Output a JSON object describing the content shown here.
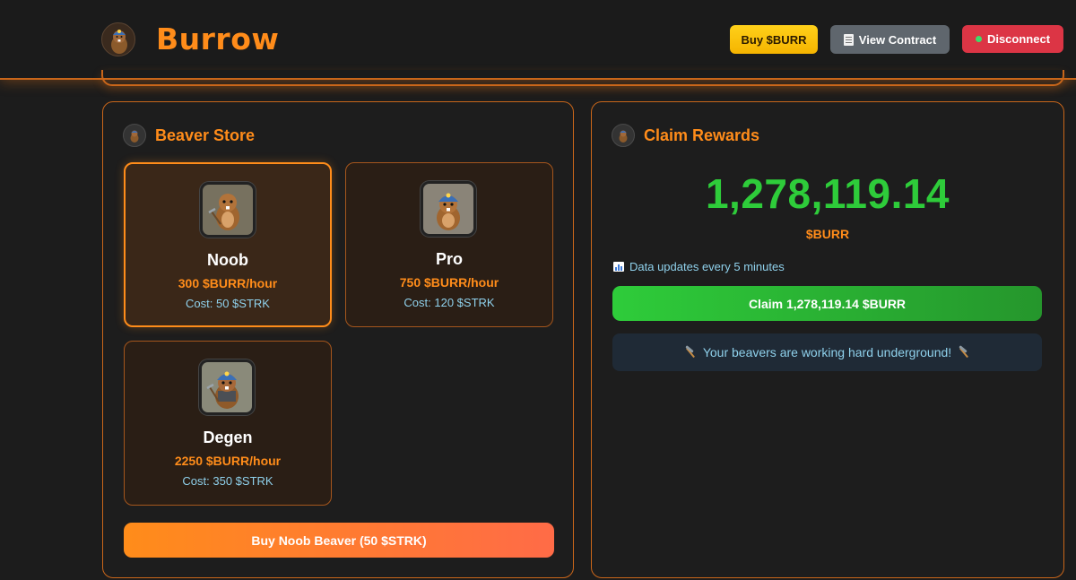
{
  "header": {
    "brand": "Burrow",
    "buy_label": "Buy $BURR",
    "view_contract_label": "View Contract",
    "disconnect_label": "Disconnect"
  },
  "store": {
    "title": "Beaver Store",
    "beavers": [
      {
        "name": "Noob",
        "rate": "300 $BURR/hour",
        "cost": "Cost: 50 $STRK",
        "selected": true,
        "icon": "beaver-noob-icon"
      },
      {
        "name": "Pro",
        "rate": "750 $BURR/hour",
        "cost": "Cost: 120 $STRK",
        "selected": false,
        "icon": "beaver-pro-icon"
      },
      {
        "name": "Degen",
        "rate": "2250 $BURR/hour",
        "cost": "Cost: 350 $STRK",
        "selected": false,
        "icon": "beaver-degen-icon"
      }
    ],
    "buy_button_label": "Buy Noob Beaver (50 $STRK)"
  },
  "claim": {
    "title": "Claim Rewards",
    "amount": "1,278,119.14",
    "unit": "$BURR",
    "update_note": "Data updates every 5 minutes",
    "claim_button_label": "Claim 1,278,119.14 $BURR",
    "status_message": "Your beavers are working hard underground!"
  },
  "colors": {
    "accent": "#ff8c1a",
    "green": "#2ecc3a",
    "disconnect": "#dc3545",
    "buy": "#f5b400"
  }
}
